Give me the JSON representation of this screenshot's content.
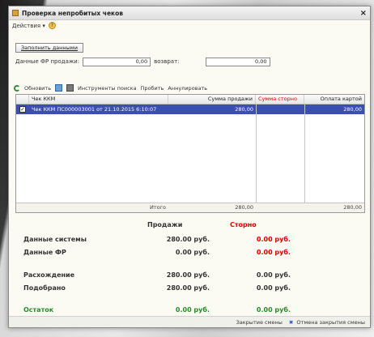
{
  "window": {
    "title": "Проверка непробитых чеков",
    "close_glyph": "×"
  },
  "menu": {
    "actions": "Действия ▾",
    "help_glyph": "?"
  },
  "fill_button": "Заполнить данными",
  "fr": {
    "label_from": "Данные ФР продажи:",
    "value_from": "0,00",
    "label_to": "возврат:",
    "value_to": "0,00"
  },
  "toolbar": {
    "refresh": "Обновить",
    "find": "Инструменты поиска",
    "check": "Пробить",
    "cancel": "Аннулировать"
  },
  "grid": {
    "columns": [
      "",
      "Чек ККМ",
      "Сумма продажи",
      "Сумма сторно",
      "Оплата картой"
    ],
    "rows": [
      {
        "checked": "✓",
        "check": "Чек ККМ ПС000003001 от 21.10.2015 6:10:07",
        "sale": "280,00",
        "storno": "",
        "card": "280,00"
      }
    ],
    "footer": {
      "label": "Итого",
      "sale": "280,00",
      "card": "280,00"
    }
  },
  "summary": {
    "sales_header": "Продажи",
    "storno_header": "Сторно",
    "rows": [
      {
        "label": "Данные системы",
        "sales": "280.00 руб.",
        "storno": "0.00 руб."
      },
      {
        "label": "Данные ФР",
        "sales": "0.00 руб.",
        "storno": "0.00 руб."
      },
      {
        "label": "Расхождение",
        "sales": "280.00 руб.",
        "storno": "0.00 руб."
      },
      {
        "label": "Подобрано",
        "sales": "280.00 руб.",
        "storno": "0.00 руб."
      },
      {
        "label": "Остаток",
        "sales": "0.00 руб.",
        "storno": "0.00 руб."
      }
    ]
  },
  "bottom": {
    "close_shift": "Закрытие смены",
    "cancel_glyph": "✖",
    "cancel_close": "Отмена закрытия смены"
  },
  "colors": {
    "selection": "#3b4fae",
    "storno": "#dd0000",
    "remainder": "#2a8a2a"
  }
}
